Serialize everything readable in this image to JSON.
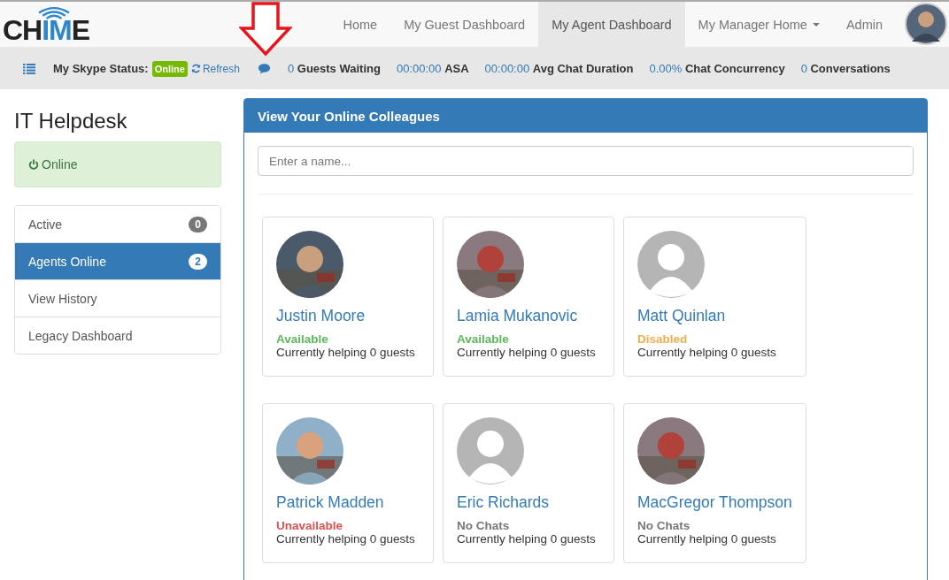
{
  "logo": [
    {
      "text": "CH",
      "accent": false
    },
    {
      "text": "IM",
      "accent": true
    },
    {
      "text": "E",
      "accent": false
    }
  ],
  "nav": [
    {
      "label": "Home",
      "selected": false,
      "dropdown": false
    },
    {
      "label": "My Guest Dashboard",
      "selected": false,
      "dropdown": false
    },
    {
      "label": "My Agent Dashboard",
      "selected": true,
      "dropdown": false
    },
    {
      "label": "My Manager Home",
      "selected": false,
      "dropdown": true
    },
    {
      "label": "Admin",
      "selected": false,
      "dropdown": false
    }
  ],
  "annotation": {
    "kind": "arrow",
    "color": "#e8141c"
  },
  "status_bar": {
    "skype_label": "My Skype Status:",
    "skype_status": "Online",
    "refresh": "Refresh",
    "stats": [
      "0 **Guests Waiting**",
      "00:00:00 **ASA**",
      "00:00:00 **Avg Chat Duration**",
      "0.00% **Chat Concurrency**",
      "0 **Conversations**"
    ]
  },
  "sidebar": {
    "title": "IT Helpdesk",
    "status": "Online",
    "items": [
      {
        "label": "Active",
        "badge": "0",
        "selected": false
      },
      {
        "label": "Agents Online",
        "badge": "2",
        "selected": true
      },
      {
        "label": "View History",
        "selected": false
      },
      {
        "label": "Legacy Dashboard",
        "selected": false
      }
    ]
  },
  "panel": {
    "title": "View Your Online Colleagues",
    "search": {
      "placeholder": "Enter a name..."
    },
    "agents": [
      {
        "name": "Justin Moore",
        "status": "Available",
        "color": "#5cb85c",
        "helping": "Currently helping 0 guests"
      },
      {
        "name": "Lamia Mukanovic",
        "status": "Available",
        "color": "#5cb85c",
        "helping": "Currently helping 0 guests"
      },
      {
        "name": "Matt Quinlan",
        "status": "Disabled",
        "color": "#f0ad4e",
        "helping": "Currently helping 0 guests",
        "avatar": {
          "kind": "default"
        }
      },
      {
        "name": "Patrick Madden",
        "status": "Unavailable",
        "color": "#d9534f",
        "helping": "Currently helping 0 guests"
      },
      {
        "name": "Eric Richards",
        "status": "No Chats",
        "color": "#777777",
        "helping": "Currently helping 0 guests",
        "avatar": {
          "kind": "default"
        }
      },
      {
        "name": "MacGregor Thompson",
        "status": "No Chats",
        "color": "#777777",
        "helping": "Currently helping 0 guests"
      }
    ]
  }
}
